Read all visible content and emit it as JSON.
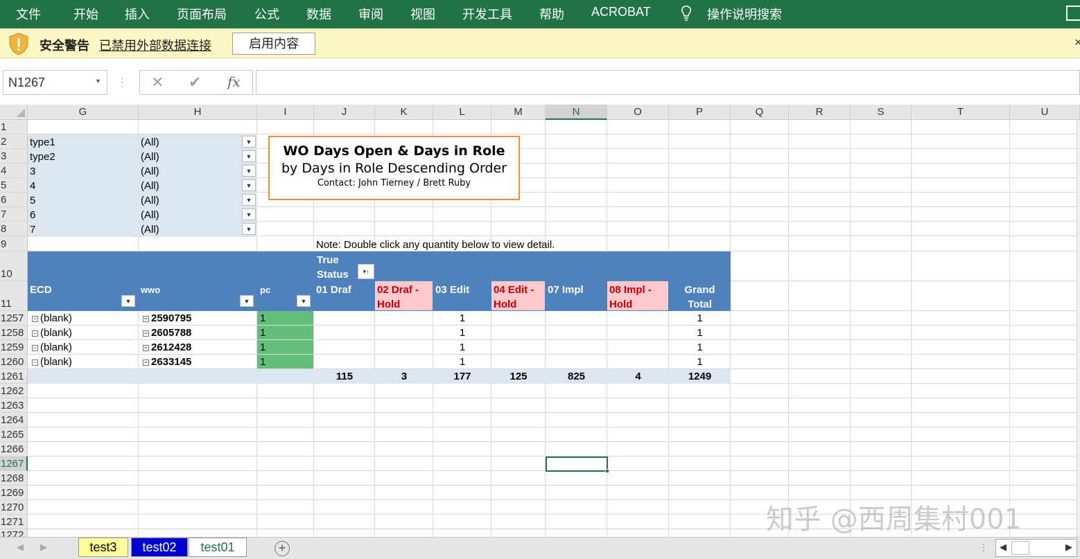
{
  "ribbon": {
    "tabs": [
      "文件",
      "开始",
      "插入",
      "页面布局",
      "公式",
      "数据",
      "审阅",
      "视图",
      "开发工具",
      "帮助",
      "ACROBAT"
    ],
    "tell_me": "操作说明搜索"
  },
  "security_bar": {
    "title": "安全警告",
    "message": "已禁用外部数据连接",
    "button": "启用内容"
  },
  "formula_bar": {
    "name_box": "N1267",
    "cancel_symbol": "✕",
    "enter_symbol": "✔",
    "fx_label": "fx",
    "formula": ""
  },
  "grid": {
    "columns": [
      "G",
      "H",
      "I",
      "J",
      "K",
      "L",
      "M",
      "N",
      "O",
      "P",
      "Q",
      "R",
      "S",
      "T",
      "U"
    ],
    "selected_column": "N",
    "rows": [
      "1",
      "2",
      "3",
      "4",
      "5",
      "6",
      "7",
      "8",
      "9",
      "10",
      "11",
      "1257",
      "1258",
      "1259",
      "1260",
      "1261",
      "1262",
      "1263",
      "1264",
      "1265",
      "1266",
      "1267",
      "1268",
      "1269",
      "1270",
      "1271",
      "1272"
    ],
    "selected_row": "1267"
  },
  "filters": [
    {
      "name": "type1",
      "value": "(All)"
    },
    {
      "name": "type2",
      "value": "(All)"
    },
    {
      "name": "3",
      "value": "(All)"
    },
    {
      "name": "4",
      "value": "(All)"
    },
    {
      "name": "5",
      "value": "(All)"
    },
    {
      "name": "6",
      "value": "(All)"
    },
    {
      "name": "7",
      "value": "(All)"
    }
  ],
  "title_box": {
    "title": "WO Days Open & Days in Role",
    "subtitle": "by Days in Role Descending Order",
    "contact": "Contact: John Tierney / Brett Ruby"
  },
  "note": "Note: Double click any quantity below to view detail.",
  "pivot": {
    "col_field_line1": "True",
    "col_field_line2": "Status",
    "row_headers": [
      "ECD",
      "wwo",
      "pc"
    ],
    "col_headers": [
      {
        "line1": "01 Draf",
        "line2": "",
        "highlight": false
      },
      {
        "line1": "02 Draf -",
        "line2": "Hold",
        "highlight": true
      },
      {
        "line1": "03 Edit",
        "line2": "",
        "highlight": false
      },
      {
        "line1": "04 Edit -",
        "line2": "Hold",
        "highlight": true
      },
      {
        "line1": "07 Impl",
        "line2": "",
        "highlight": false
      },
      {
        "line1": "08 Impl -",
        "line2": "Hold",
        "highlight": true
      },
      {
        "line1": "Grand",
        "line2": "Total",
        "highlight": false
      }
    ],
    "rows": [
      {
        "ecd": "(blank)",
        "wwo": "2590795",
        "pc": "1",
        "edit": "1",
        "total": "1"
      },
      {
        "ecd": "(blank)",
        "wwo": "2605788",
        "pc": "1",
        "edit": "1",
        "total": "1"
      },
      {
        "ecd": "(blank)",
        "wwo": "2612428",
        "pc": "1",
        "edit": "1",
        "total": "1"
      },
      {
        "ecd": "(blank)",
        "wwo": "2633145",
        "pc": "1",
        "edit": "1",
        "total": "1"
      }
    ],
    "totals": [
      "115",
      "3",
      "177",
      "125",
      "825",
      "4",
      "1249"
    ]
  },
  "watermark": "知乎 @西周集村001",
  "sheet_tabs": [
    {
      "label": "test3",
      "bg": "#ffff99",
      "color": "#000000"
    },
    {
      "label": "test02",
      "bg": "#0000cc",
      "color": "#ffffff"
    },
    {
      "label": "test01",
      "bg": "#ffffff",
      "color": "#217346"
    }
  ],
  "colors": {
    "ribbon": "#217346",
    "pivot_header": "#4f81bd",
    "hold_header": "#ffc7ce",
    "pc_green": "#63be7b",
    "filter_bg": "#dce6f1",
    "title_border": "#ed8f35"
  }
}
